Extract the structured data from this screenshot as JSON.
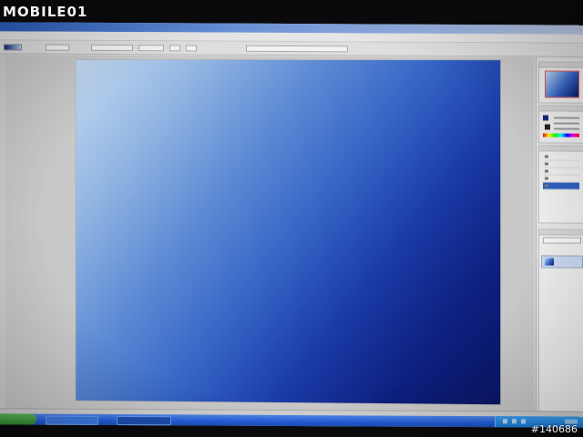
{
  "photo": {
    "watermark": "MOBILE01",
    "photo_id": "#140686"
  },
  "app": {
    "canvas_gradient_colors": [
      "#c4daf2",
      "#5d8ad4",
      "#1a3aa6",
      "#0a1766"
    ],
    "accent_taskbar": "#245edb",
    "panels": [
      "navigator",
      "color",
      "history",
      "layers"
    ]
  },
  "icons": {
    "watermark_logo": "mobile01-logo",
    "start": "start-button-icon",
    "tray": "system-tray-icons"
  }
}
